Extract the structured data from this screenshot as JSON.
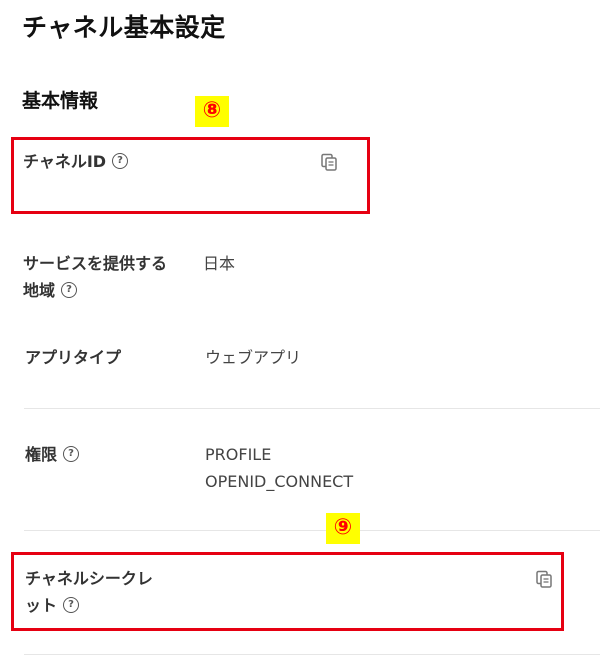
{
  "page": {
    "title": "チャネル基本設定"
  },
  "basic_info": {
    "section_title": "基本情報",
    "channel_id": {
      "label": "チャネルID",
      "help_icon": "help-circle-icon",
      "copy_icon": "copy-icon"
    },
    "service_region": {
      "label_line1": "サービスを提供する",
      "label_line2": "地域",
      "value": "日本",
      "help_icon": "help-circle-icon"
    },
    "app_type": {
      "label": "アプリタイプ",
      "value": "ウェブアプリ"
    },
    "permissions": {
      "label": "権限",
      "values": [
        "PROFILE",
        "OPENID_CONNECT"
      ],
      "help_icon": "help-circle-icon"
    },
    "channel_secret": {
      "label_line1": "チャネルシークレ",
      "label_line2": "ット",
      "help_icon": "help-circle-icon",
      "copy_icon": "copy-icon"
    }
  },
  "annotations": {
    "marker_8": "⑧",
    "marker_9": "⑨",
    "highlight_color": "#e60012",
    "marker_bg": "#ffff00",
    "marker_color": "#ff0000"
  },
  "help_glyph": "?"
}
